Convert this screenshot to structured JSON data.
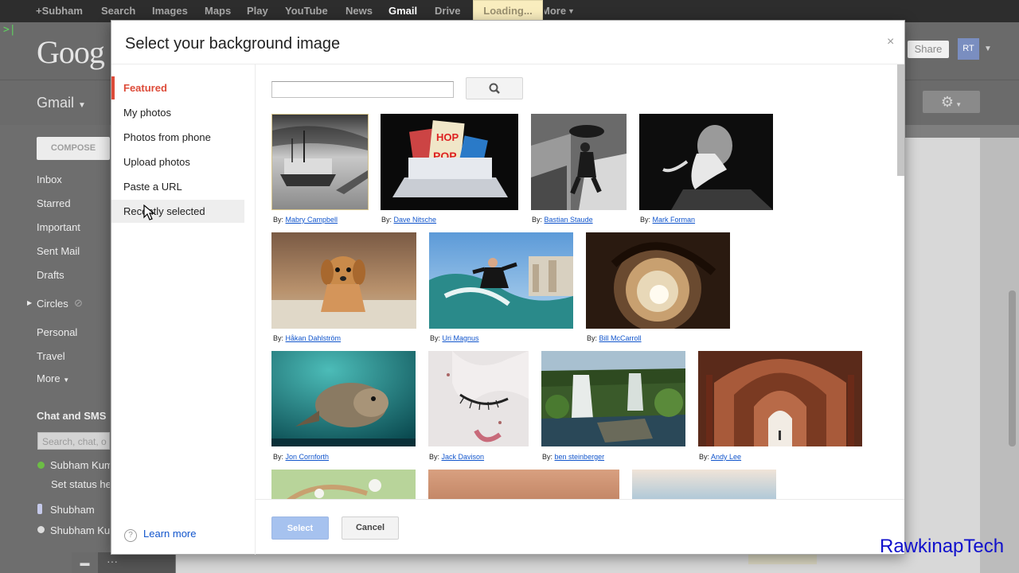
{
  "topbar": {
    "items": [
      "+Subham",
      "Search",
      "Images",
      "Maps",
      "Play",
      "YouTube",
      "News",
      "Gmail",
      "Drive"
    ],
    "loading": "Loading...",
    "more": "More"
  },
  "header": {
    "logo": "Goog",
    "share": "Share",
    "avatar_initials": "RT"
  },
  "gmail_label": "Gmail",
  "compose": "COMPOSE",
  "nav": [
    "Inbox",
    "Starred",
    "Important",
    "Sent Mail",
    "Drafts",
    "Circles",
    "Personal",
    "Travel",
    "More"
  ],
  "chat": {
    "heading": "Chat and SMS",
    "search_placeholder": "Search, chat, o",
    "contacts": [
      "Subham Kum",
      "Set status he",
      "Shubham",
      "Shubham Ku"
    ]
  },
  "dialog": {
    "title": "Select your background image",
    "close": "×",
    "sidebar": [
      "Featured",
      "My photos",
      "Photos from phone",
      "Upload photos",
      "Paste a URL",
      "Recently selected"
    ],
    "learn_more": "Learn more",
    "search_value": "",
    "select_label": "Select",
    "cancel_label": "Cancel",
    "by_label": "By:",
    "photos": [
      {
        "author": "Mabry Campbell"
      },
      {
        "author": "Dave Nitsche"
      },
      {
        "author": "Bastian Staude"
      },
      {
        "author": "Mark Forman"
      },
      {
        "author": "Håkan Dahlström"
      },
      {
        "author": "Uri Magnus"
      },
      {
        "author": "Bill McCarroll"
      },
      {
        "author": "Jon Cornforth"
      },
      {
        "author": "Jack Davison"
      },
      {
        "author": "ben steinberger"
      },
      {
        "author": "Andy Lee"
      }
    ]
  },
  "watermark": "RawkinapTech",
  "colors": {
    "accent_red": "#dd4b39",
    "link_blue": "#1155cc",
    "select_btn": "#a6c2ef"
  }
}
